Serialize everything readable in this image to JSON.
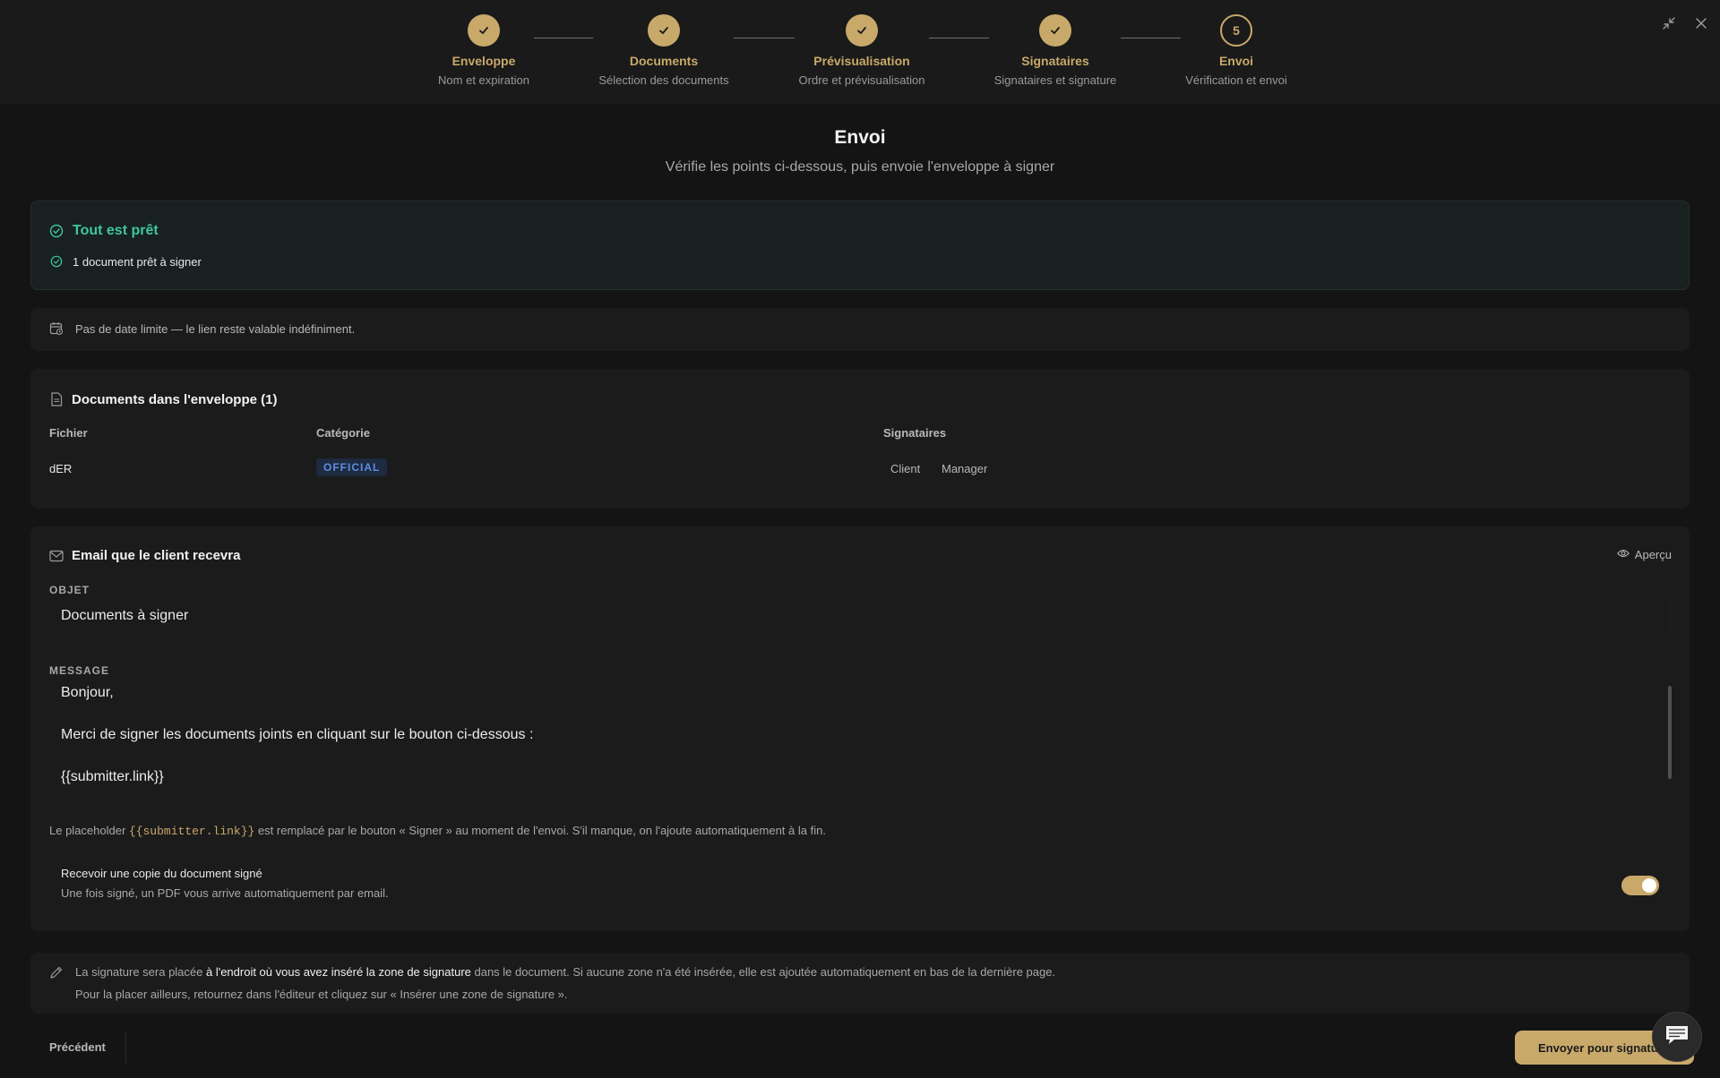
{
  "stepper": [
    {
      "title": "Enveloppe",
      "sub": "Nom et expiration",
      "state": "done"
    },
    {
      "title": "Documents",
      "sub": "Sélection des documents",
      "state": "done"
    },
    {
      "title": "Prévisualisation",
      "sub": "Ordre et prévisualisation",
      "state": "done"
    },
    {
      "title": "Signataires",
      "sub": "Signataires et signature",
      "state": "done"
    },
    {
      "title": "Envoi",
      "sub": "Vérification et envoi",
      "state": "current",
      "number": "5"
    }
  ],
  "header": {
    "title": "Envoi",
    "subtitle": "Vérifie les points ci-dessous, puis envoie l'enveloppe à signer"
  },
  "ready": {
    "title": "Tout est prêt",
    "line": "1 document prêt à signer"
  },
  "deadline": {
    "text": "Pas de date limite — le lien reste valable indéfiniment."
  },
  "documents": {
    "title": "Documents dans l'enveloppe (1)",
    "columns": [
      "Fichier",
      "Catégorie",
      "Signataires"
    ],
    "rows": [
      {
        "file": "dER",
        "category": "OFFICIAL",
        "signers": [
          "Client",
          "Manager"
        ]
      }
    ]
  },
  "email": {
    "title": "Email que le client recevra",
    "preview_label": "Aperçu",
    "subject_label": "OBJET",
    "subject_value": "Documents à signer",
    "message_label": "MESSAGE",
    "message_lines": [
      "Bonjour,",
      "Merci de signer les documents joints en cliquant sur le bouton ci-dessous :",
      "{{submitter.link}}"
    ],
    "hint_before": "Le placeholder ",
    "hint_code": "{{submitter.link}}",
    "hint_after": " est remplacé par le bouton « Signer » au moment de l'envoi. S'il manque, on l'ajoute automatiquement à la fin.",
    "copy_title": "Recevoir une copie du document signé",
    "copy_sub": "Une fois signé, un PDF vous arrive automatiquement par email.",
    "copy_enabled": true
  },
  "signature_note": {
    "line1_before": "La signature sera placée ",
    "line1_strong": "à l'endroit où vous avez inséré la zone de signature",
    "line1_after": " dans le document. Si aucune zone n'a été insérée, elle est ajoutée automatiquement en bas de la dernière page.",
    "line2": "Pour la placer ailleurs, retournez dans l'éditeur et cliquez sur « Insérer une zone de signature »."
  },
  "footer": {
    "prev_label": "Précédent",
    "send_label": "Envoyer pour signature"
  },
  "colors": {
    "accent": "#c9a96a",
    "success": "#3fc79a",
    "badge_blue": "#5e8ee0",
    "background": "#141414"
  }
}
